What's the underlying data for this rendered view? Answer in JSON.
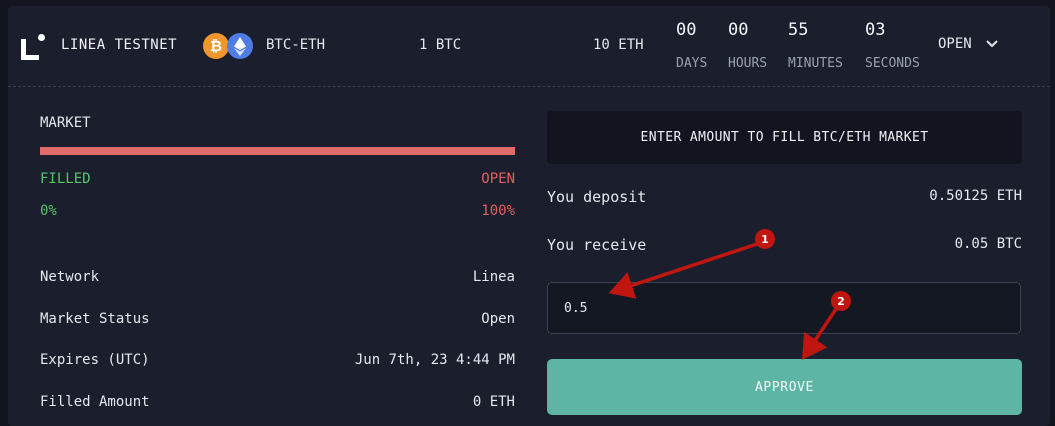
{
  "header": {
    "network": "LINEA TESTNET",
    "pair": "BTC-ETH",
    "amount_btc": "1 BTC",
    "amount_eth": "10 ETH",
    "countdown": [
      {
        "value": "00",
        "label": "DAYS"
      },
      {
        "value": "00",
        "label": "HOURS"
      },
      {
        "value": "55",
        "label": "MINUTES"
      },
      {
        "value": "03",
        "label": "SECONDS"
      }
    ],
    "status": "OPEN"
  },
  "market": {
    "title": "MARKET",
    "filled_label": "FILLED",
    "open_label": "OPEN",
    "filled_pct": "0%",
    "open_pct": "100%",
    "filled_fraction": 0
  },
  "details": [
    {
      "label": "Network",
      "value": "Linea"
    },
    {
      "label": "Market Status",
      "value": "Open"
    },
    {
      "label": "Expires (UTC)",
      "value": "Jun 7th, 23 4:44 PM"
    },
    {
      "label": "Filled Amount",
      "value": "0 ETH"
    }
  ],
  "fill": {
    "prompt": "ENTER AMOUNT TO FILL BTC/ETH MARKET",
    "deposit_label": "You deposit",
    "deposit_value": "0.50125 ETH",
    "receive_label": "You receive",
    "receive_value": "0.05 BTC",
    "input_value": "0.5",
    "approve_label": "APPROVE"
  },
  "annotations": [
    "1",
    "2"
  ],
  "colors": {
    "background": "#12151f",
    "panel": "#1b1f2d",
    "open_bar": "#e36b6b",
    "filled_green": "#58c26b",
    "open_red": "#e35f5f",
    "approve_button": "#5fb5a5",
    "annotation_red": "#c0160f",
    "btc": "#f0962f",
    "eth": "#4f7de5"
  }
}
